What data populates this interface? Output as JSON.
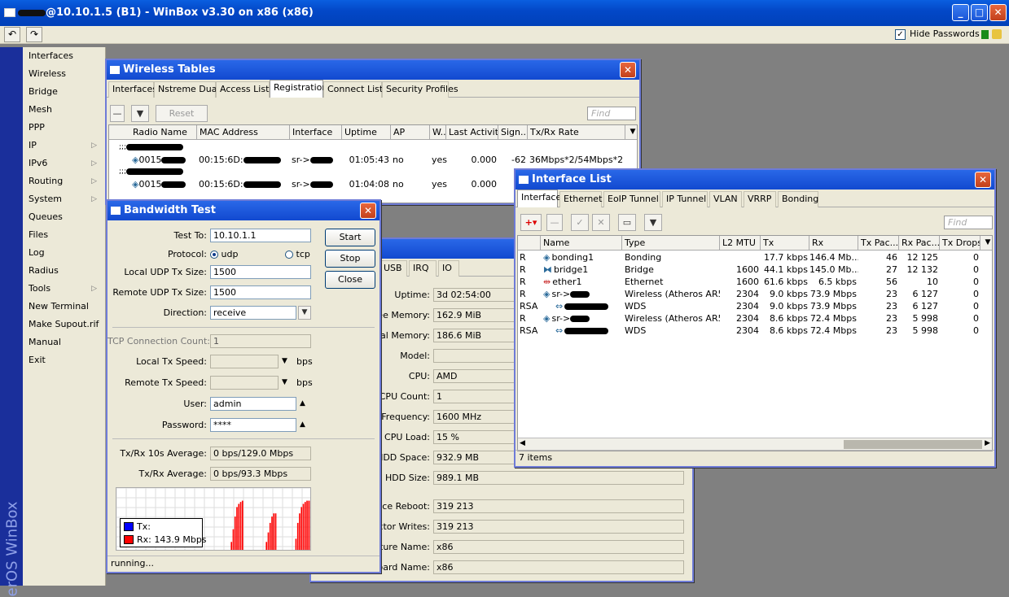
{
  "app": {
    "title": "@10.10.1.5 (B1) - WinBox v3.30 on x86 (x86)",
    "hide_passwords_label": "Hide Passwords",
    "brand_text": "erOS WinBox"
  },
  "menu": [
    {
      "label": "Interfaces",
      "sub": false
    },
    {
      "label": "Wireless",
      "sub": false
    },
    {
      "label": "Bridge",
      "sub": false
    },
    {
      "label": "Mesh",
      "sub": false
    },
    {
      "label": "PPP",
      "sub": false
    },
    {
      "label": "IP",
      "sub": true
    },
    {
      "label": "IPv6",
      "sub": true
    },
    {
      "label": "Routing",
      "sub": true
    },
    {
      "label": "System",
      "sub": true
    },
    {
      "label": "Queues",
      "sub": false
    },
    {
      "label": "Files",
      "sub": false
    },
    {
      "label": "Log",
      "sub": false
    },
    {
      "label": "Radius",
      "sub": false
    },
    {
      "label": "Tools",
      "sub": true
    },
    {
      "label": "New Terminal",
      "sub": false
    },
    {
      "label": "Make Supout.rif",
      "sub": false
    },
    {
      "label": "Manual",
      "sub": false
    },
    {
      "label": "Exit",
      "sub": false
    }
  ],
  "wireless": {
    "title": "Wireless Tables",
    "tabs": [
      "Interfaces",
      "Nstreme Dual",
      "Access List",
      "Registration",
      "Connect List",
      "Security Profiles"
    ],
    "active_tab": 3,
    "reset_label": "Reset",
    "find_placeholder": "Find",
    "columns": [
      "Radio Name",
      "MAC Address",
      "Interface",
      "Uptime",
      "AP",
      "W...",
      "Last Activit...",
      "Sign...",
      "Tx/Rx Rate"
    ],
    "rows": [
      {
        "comment": ";;;",
        "radio": "0015",
        "mac": "00:15:6D:",
        "iface": "sr->",
        "uptime": "01:05:43",
        "ap": "no",
        "wds": "yes",
        "last": "0.000",
        "signal": "-62",
        "rate": "36Mbps*2/54Mbps*2"
      },
      {
        "comment": ";;;",
        "radio": "0015",
        "mac": "00:15:6D:",
        "iface": "sr->",
        "uptime": "01:04:08",
        "ap": "no",
        "wds": "yes",
        "last": "0.000",
        "signal": "",
        "rate": ""
      }
    ]
  },
  "resources": {
    "tabs": [
      "USB",
      "IRQ",
      "IO"
    ],
    "rows": [
      {
        "label": "Uptime:",
        "value": "3d 02:54:00"
      },
      {
        "label": "ree Memory:",
        "value": "162.9 MiB"
      },
      {
        "label": "otal Memory:",
        "value": "186.6 MiB"
      },
      {
        "label": "Model:",
        "value": ""
      },
      {
        "label": "CPU:",
        "value": "AMD"
      },
      {
        "label": "CPU Count:",
        "value": "1"
      },
      {
        "label": "Frequency:",
        "value": "1600 MHz"
      },
      {
        "label": "CPU Load:",
        "value": "15 %"
      },
      {
        "label": "HDD Space:",
        "value": "932.9 MB"
      },
      {
        "label": "al HDD Size:",
        "value": "989.1 MB"
      },
      {
        "label": "nce Reboot:",
        "value": "319 213"
      },
      {
        "label": "ector Writes:",
        "value": "319 213"
      },
      {
        "label": "cture Name:",
        "value": "x86"
      },
      {
        "label": "Board Name:",
        "value": "x86"
      }
    ]
  },
  "bandwidth": {
    "title": "Bandwidth Test",
    "test_to_label": "Test To:",
    "test_to": "10.10.1.1",
    "protocol_label": "Protocol:",
    "udp": "udp",
    "tcp": "tcp",
    "protocol": "udp",
    "local_udp_label": "Local UDP Tx Size:",
    "local_udp": "1500",
    "remote_udp_label": "Remote UDP Tx Size:",
    "remote_udp": "1500",
    "direction_label": "Direction:",
    "direction": "receive",
    "tcp_count_label": "TCP Connection Count:",
    "tcp_count": "1",
    "local_tx_label": "Local Tx Speed:",
    "remote_tx_label": "Remote Tx Speed:",
    "bps": "bps",
    "user_label": "User:",
    "user": "admin",
    "password_label": "Password:",
    "password": "****",
    "avg10_label": "Tx/Rx 10s Average:",
    "avg10": "0 bps/129.0 Mbps",
    "avg_label": "Tx/Rx Average:",
    "avg": "0 bps/93.3 Mbps",
    "start": "Start",
    "stop": "Stop",
    "close": "Close",
    "legend_tx": "Tx:",
    "legend_rx": "Rx:",
    "rx_value": "143.9 Mbps",
    "tx_color": "#0000ff",
    "rx_color": "#ff0000",
    "graph_bars": [
      0,
      0,
      0,
      0,
      0,
      0,
      0,
      0,
      0,
      0,
      0,
      0,
      0,
      0,
      0,
      0,
      0,
      0,
      0,
      0,
      0,
      0,
      0,
      0,
      0,
      0,
      0,
      0,
      0,
      0,
      0,
      0,
      0,
      0,
      0,
      0,
      0,
      0,
      0,
      0,
      0,
      0,
      0,
      0,
      0,
      0,
      0,
      0,
      0,
      0,
      0,
      0,
      0,
      0,
      0,
      0,
      0,
      0,
      0,
      0,
      0,
      0,
      0.15,
      0.35,
      0.55,
      0.7,
      0.75,
      0.78,
      0.8,
      0,
      0,
      0,
      0,
      0,
      0,
      0,
      0,
      0,
      0,
      0,
      0,
      0.15,
      0.3,
      0.45,
      0.55,
      0.6,
      0.6,
      0,
      0,
      0,
      0,
      0,
      0,
      0,
      0,
      0,
      0,
      0.2,
      0.45,
      0.6,
      0.7,
      0.75,
      0.78,
      0.8,
      0.8,
      0.8
    ],
    "status": "running..."
  },
  "iflist": {
    "title": "Interface List",
    "tabs": [
      "Interface",
      "Ethernet",
      "EoIP Tunnel",
      "IP Tunnel",
      "VLAN",
      "VRRP",
      "Bonding"
    ],
    "active_tab": 0,
    "find_placeholder": "Find",
    "columns": [
      "Name",
      "Type",
      "L2 MTU",
      "Tx",
      "Rx",
      "Tx Pac...",
      "Rx Pac...",
      "Tx Drops"
    ],
    "rows": [
      {
        "flag": "R",
        "name": "bonding1",
        "type": "Bonding",
        "mtu": "",
        "tx": "17.7 kbps",
        "rx": "146.4 Mb...",
        "txp": "46",
        "rxp": "12 125",
        "drops": "0"
      },
      {
        "flag": "R",
        "name": "bridge1",
        "type": "Bridge",
        "mtu": "1600",
        "tx": "44.1 kbps",
        "rx": "145.0 Mb...",
        "txp": "27",
        "rxp": "12 132",
        "drops": "0"
      },
      {
        "flag": "R",
        "name": "ether1",
        "type": "Ethernet",
        "mtu": "1600",
        "tx": "61.6 kbps",
        "rx": "6.5 kbps",
        "txp": "56",
        "rxp": "10",
        "drops": "0"
      },
      {
        "flag": "R",
        "name": "sr->",
        "type": "Wireless (Atheros AR5...",
        "mtu": "2304",
        "tx": "9.0 kbps",
        "rx": "73.9 Mbps",
        "txp": "23",
        "rxp": "6 127",
        "drops": "0"
      },
      {
        "flag": "RSA",
        "name": "",
        "type": "WDS",
        "mtu": "2304",
        "tx": "9.0 kbps",
        "rx": "73.9 Mbps",
        "txp": "23",
        "rxp": "6 127",
        "drops": "0"
      },
      {
        "flag": "R",
        "name": "sr->",
        "type": "Wireless (Atheros AR5...",
        "mtu": "2304",
        "tx": "8.6 kbps",
        "rx": "72.4 Mbps",
        "txp": "23",
        "rxp": "5 998",
        "drops": "0"
      },
      {
        "flag": "RSA",
        "name": "",
        "type": "WDS",
        "mtu": "2304",
        "tx": "8.6 kbps",
        "rx": "72.4 Mbps",
        "txp": "23",
        "rxp": "5 998",
        "drops": "0"
      }
    ],
    "items": "7 items"
  }
}
